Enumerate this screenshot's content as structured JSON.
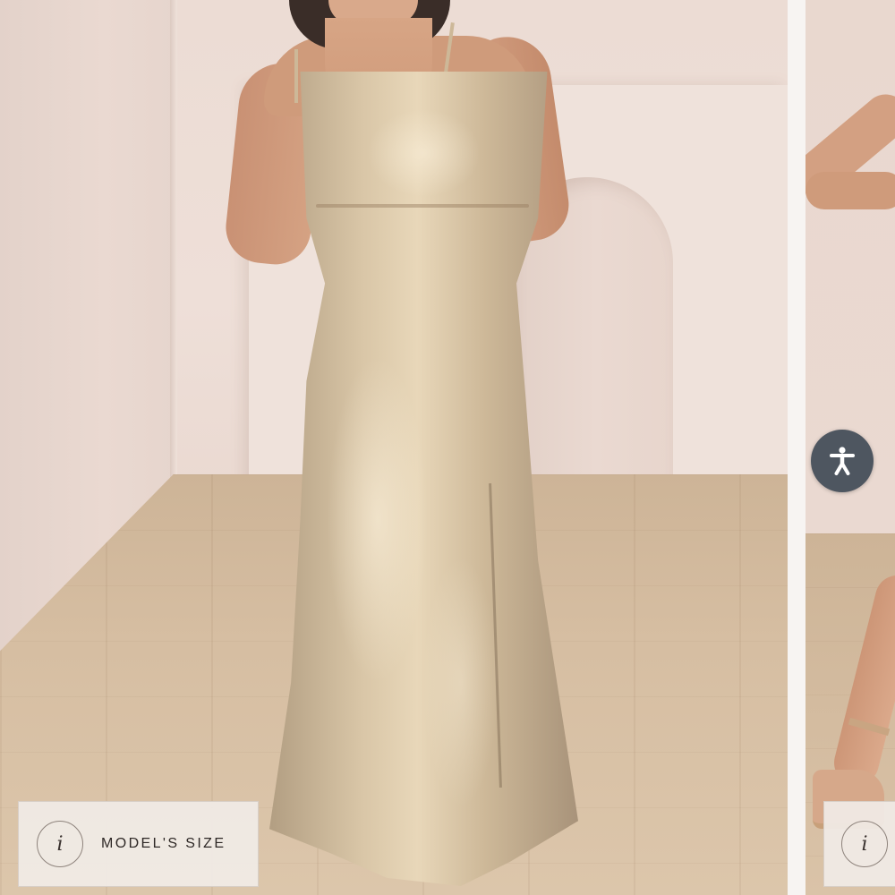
{
  "gallery": {
    "main_image_alt": "",
    "model_size_button": {
      "label": "MODEL'S SIZE",
      "info_glyph": "i"
    },
    "next_model_size_button": {
      "info_glyph": "i"
    }
  },
  "accessibility": {
    "icon": "accessibility-person-icon",
    "background": "#4e5660"
  },
  "colors": {
    "page_background": "#f4efec",
    "pill_background": "#f1ece7",
    "pill_text": "#2e2826"
  }
}
